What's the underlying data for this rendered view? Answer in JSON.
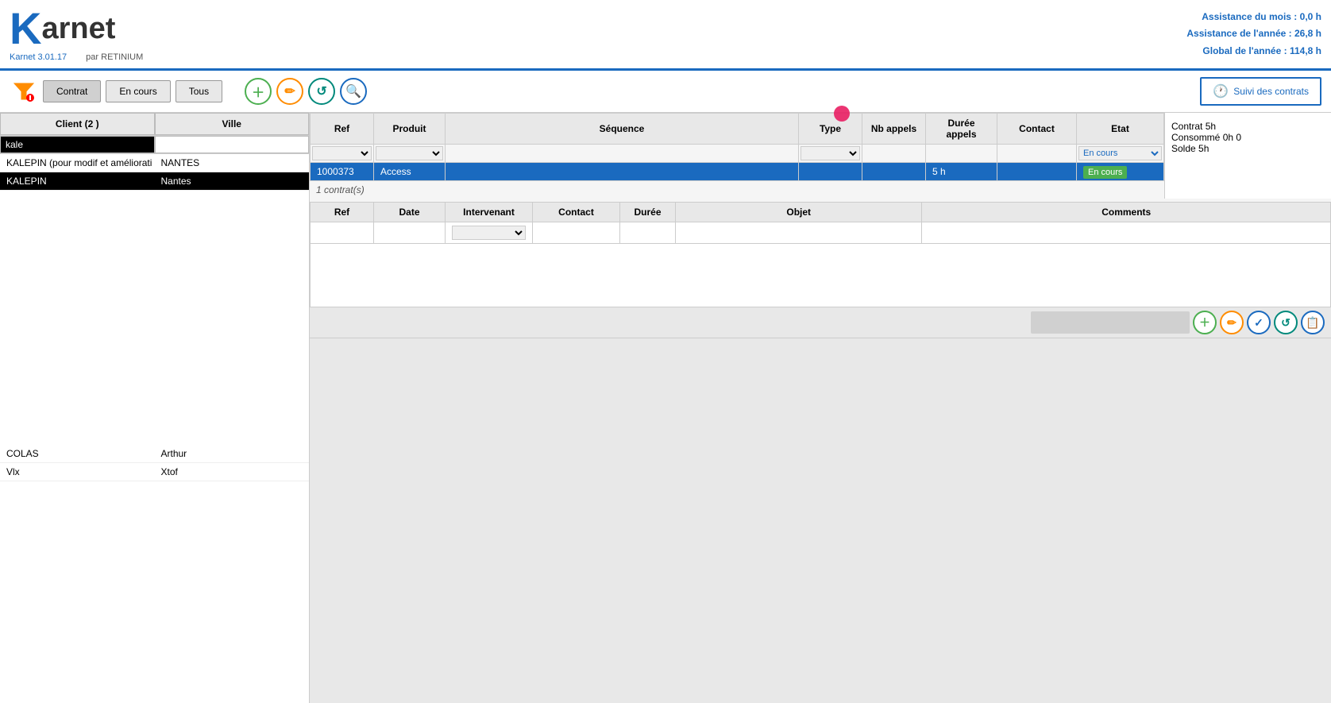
{
  "header": {
    "logo_k": "K",
    "logo_rest": "arnet",
    "version": "Karnet 3.01.17",
    "by": "par RETINIUM",
    "stat1_label": "Assistance du mois :",
    "stat1_value": "0,0 h",
    "stat2_label": "Assistance de l'année :",
    "stat2_value": "26,8 h",
    "stat3_label": "Global de l'année :",
    "stat3_value": "114,8 h"
  },
  "toolbar": {
    "filter_label": "Contrat",
    "btn_contrat": "Contrat",
    "btn_en_cours": "En cours",
    "btn_tous": "Tous",
    "btn_suivi": "Suivi des contrats"
  },
  "clients": {
    "col_client": "Client (2 )",
    "col_ville": "Ville",
    "search_value": "kale",
    "rows": [
      {
        "client": "KALEPIN (pour modif et améliorati",
        "ville": "NANTES"
      },
      {
        "client": "KALEPIN",
        "ville": "Nantes"
      }
    ],
    "bottom_rows": [
      {
        "client": "COLAS",
        "ville": "Arthur"
      },
      {
        "client": "Vlx",
        "ville": "Xtof"
      }
    ]
  },
  "contracts": {
    "col_ref": "Ref",
    "col_produit": "Produit",
    "col_sequence": "Séquence",
    "col_type": "Type",
    "col_nb_appels": "Nb appels",
    "col_duree_appels": "Durée appels",
    "col_contact": "Contact",
    "col_etat": "Etat",
    "filter_etat_value": "En cours",
    "rows": [
      {
        "ref": "1000373",
        "produit": "Access",
        "sequence": "",
        "type": "",
        "nb_appels": "",
        "duree_appels": "5 h",
        "contact": "",
        "etat": "En cours"
      }
    ],
    "count": "1 contrat(s)"
  },
  "side_info": {
    "contrat_label": "Contrat",
    "contrat_value": "5h",
    "consomme_label": "Consommé",
    "consomme_value": "0h 0",
    "solde_label": "Solde",
    "solde_value": "5h"
  },
  "interventions": {
    "col_ref": "Ref",
    "col_date": "Date",
    "col_intervenant": "Intervenant",
    "col_contact": "Contact",
    "col_duree": "Durée",
    "col_objet": "Objet",
    "col_comments": "Comments",
    "rows": []
  }
}
